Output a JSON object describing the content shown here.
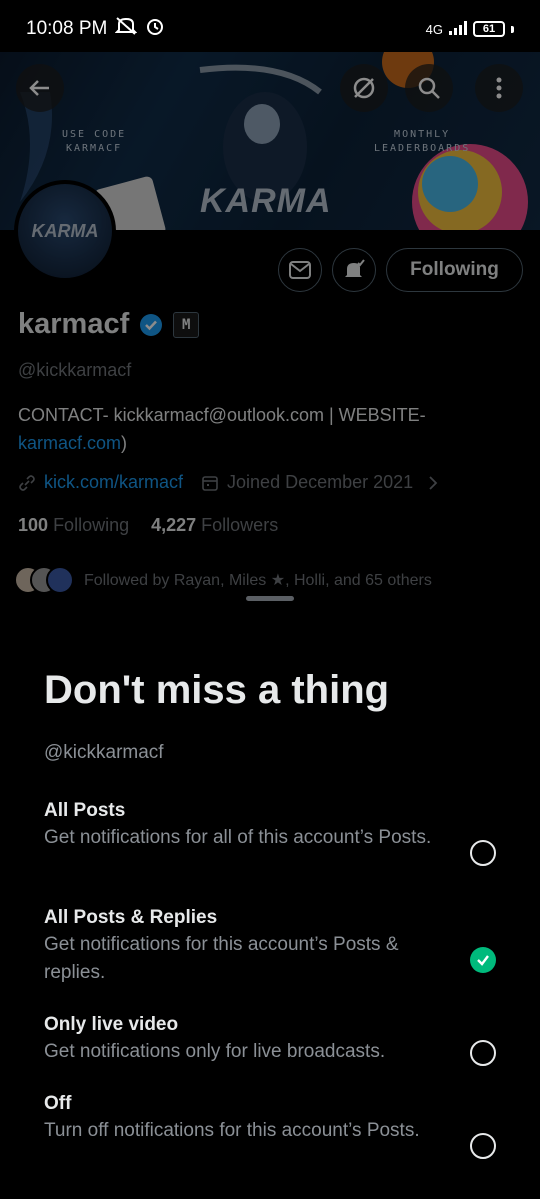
{
  "status_bar": {
    "time": "10:08 PM",
    "network": "4G",
    "battery": "61",
    "icons": [
      "mute-icon",
      "alarm-icon",
      "signal-icon",
      "battery-icon"
    ]
  },
  "banner": {
    "left_text_1": "USE CODE",
    "left_text_2": "KARMACF",
    "right_text_1": "MONTHLY",
    "right_text_2": "LEADERBOARDS",
    "logo_text": "KARMA"
  },
  "avatar": {
    "text": "KARMA"
  },
  "profile": {
    "name": "karmacf",
    "badge": "M",
    "handle": "@kickkarmacf",
    "bio_prefix": "CONTACT- kickkarmacf@outlook.com | WEBSITE-",
    "bio_link": "karmacf.com",
    "bio_suffix": ")",
    "website": "kick.com/karmacf",
    "joined": "Joined December 2021",
    "following_count": "100",
    "following_label": "Following",
    "followers_count": "4,227",
    "followers_label": "Followers",
    "followed_by": "Followed by Rayan, Miles ★, Holli, and 65 others"
  },
  "actions": {
    "following_button": "Following"
  },
  "sheet": {
    "title": "Don't miss a thing",
    "handle": "@kickkarmacf",
    "options": [
      {
        "title": "All Posts",
        "desc": "Get notifications for all of this account’s Posts.",
        "selected": false
      },
      {
        "title": "All Posts & Replies",
        "desc": "Get notifications for this account’s Posts & replies.",
        "selected": true
      },
      {
        "title": "Only live video",
        "desc": "Get notifications only for live broadcasts.",
        "selected": false
      },
      {
        "title": "Off",
        "desc": "Turn off notifications for this account’s Posts.",
        "selected": false
      }
    ]
  },
  "colors": {
    "accent": "#1d9bf0",
    "check": "#00ba7c",
    "muted": "#71767b"
  }
}
